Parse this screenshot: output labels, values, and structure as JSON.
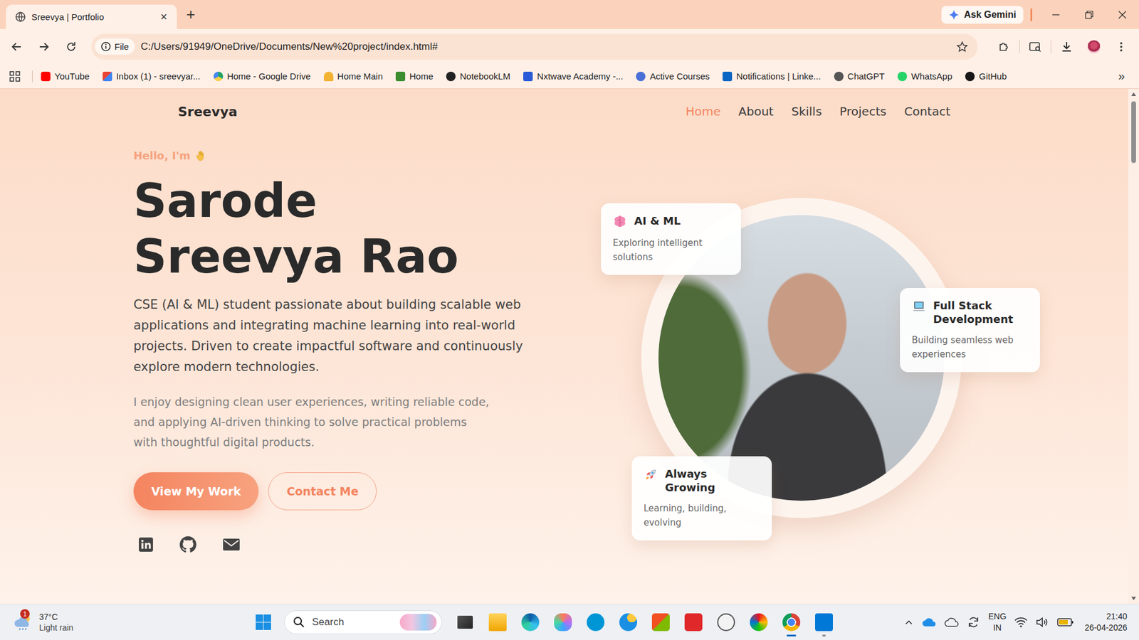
{
  "browser": {
    "tabs": [
      {
        "title": "Sreevya | Portfolio",
        "selected": true,
        "close": "×"
      }
    ],
    "new_tab": "+",
    "ask_gemini": "Ask Gemini",
    "address": {
      "chip": "File",
      "url": "C:/Users/91949/OneDrive/Documents/New%20project/index.html#"
    },
    "bookmarks": [
      "YouTube",
      "Inbox (1) - sreevyar...",
      "Home - Google Drive",
      "Home Main",
      "Home",
      "NotebookLM",
      "Nxtwave Academy -...",
      "Active Courses",
      "Notifications | Linke...",
      "ChatGPT",
      "WhatsApp",
      "GitHub"
    ],
    "bookmarks_more": "»"
  },
  "page": {
    "brand": "Sreevya",
    "nav": [
      {
        "label": "Home",
        "selected": true
      },
      {
        "label": "About",
        "selected": false
      },
      {
        "label": "Skills",
        "selected": false
      },
      {
        "label": "Projects",
        "selected": false
      },
      {
        "label": "Contact",
        "selected": false
      }
    ],
    "greeting": "Hello, I'm",
    "name_lines": [
      "Sarode",
      "Sreevya Rao"
    ],
    "intro": "CSE (AI & ML) student passionate about building scalable web applications and integrating machine learning into real-world projects. Driven to create impactful software and continuously explore modern technologies.",
    "detail": "I enjoy designing clean user experiences, writing reliable code, and applying AI-driven thinking to solve practical problems with thoughtful digital products.",
    "buttons": [
      {
        "label": "View My Work",
        "kind": "primary"
      },
      {
        "label": "Contact Me",
        "kind": "outline"
      }
    ],
    "highlights": [
      {
        "title": "AI & ML",
        "text": "Exploring intelligent solutions"
      },
      {
        "title": "Full Stack Development",
        "text": "Building seamless web experiences"
      },
      {
        "title": "Always Growing",
        "text": "Learning, building, evolving"
      }
    ]
  },
  "taskbar": {
    "weather": {
      "badge": "1",
      "temp": "37°C",
      "condition": "Light rain"
    },
    "search": "Search",
    "apps": [
      {
        "running": false,
        "selected": false
      },
      {
        "running": false,
        "selected": false
      },
      {
        "running": false,
        "selected": false
      },
      {
        "running": false,
        "selected": false
      },
      {
        "running": false,
        "selected": false
      },
      {
        "running": false,
        "selected": false
      },
      {
        "running": false,
        "selected": false
      },
      {
        "running": false,
        "selected": false
      },
      {
        "running": false,
        "selected": false
      },
      {
        "running": false,
        "selected": false
      },
      {
        "running": true,
        "selected": true
      },
      {
        "running": true,
        "selected": false
      }
    ],
    "language": "ENG",
    "region": "IN",
    "time": "21:40",
    "date": "26-04-2026"
  }
}
